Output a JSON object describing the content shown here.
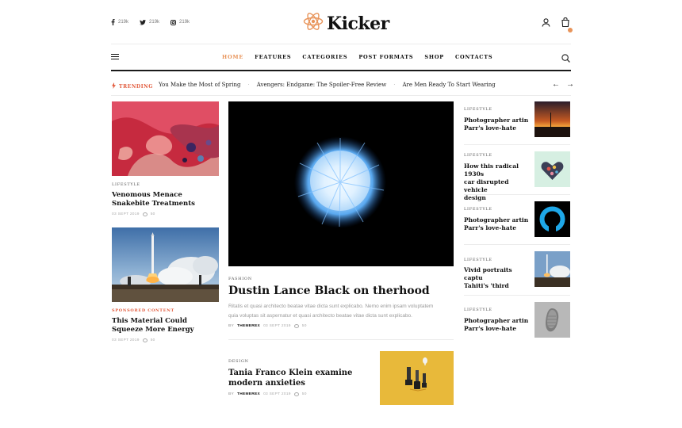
{
  "social": [
    {
      "icon": "facebook-icon",
      "count": "219k"
    },
    {
      "icon": "twitter-icon",
      "count": "219k"
    },
    {
      "icon": "instagram-icon",
      "count": "219k"
    }
  ],
  "brand": {
    "name": "Kicker",
    "accent": "#e8945a",
    "trend_color": "#e25a3c"
  },
  "nav": {
    "items": [
      "HOME",
      "FEATURES",
      "CATEGORIES",
      "POST FORMATS",
      "SHOP",
      "CONTACTS"
    ],
    "active": "HOME"
  },
  "trending": {
    "label": "TRENDING",
    "items": [
      "You Make the Most of Spring",
      "Avengers: Endgame: The Spoiler-Free Review",
      "Are Men Ready To Start Wearing"
    ],
    "prev": "←",
    "next": "→"
  },
  "left": [
    {
      "category": "LIFESTYLE",
      "title": "Venomous Menace Snakebite Treatments",
      "date": "03 SEPT 2019",
      "comments": "50"
    },
    {
      "category": "SPONSORED CONTENT",
      "title": "This Material Could Squeeze More Energy",
      "date": "03 SEPT 2019",
      "comments": "50"
    }
  ],
  "featured": {
    "category": "FASHION",
    "title": "Dustin Lance Black on therhood",
    "excerpt_1": "Ritatis et quasi architecto beatae vitae dicta sunt explicabo. Nemo enim ipsam voluptatem",
    "excerpt_2": "quia voluptas sit aspernatur et quasi architecto beatae vitae dicta sunt explicabo.",
    "by": "BY",
    "author": "THEMEREX",
    "date": "03 SEPT 2019",
    "comments": "50"
  },
  "secondary": {
    "category": "DESIGN",
    "title_1": "Tania Franco Klein examine",
    "title_2": "modern anxieties",
    "by": "BY",
    "author": "THEMEREX",
    "date": "03 SEPT 2019",
    "comments": "50"
  },
  "right": [
    {
      "category": "LIFESTYLE",
      "title_1": "Photographer artin",
      "title_2": "Parr's love-hate",
      "title_3": ""
    },
    {
      "category": "LIFESTYLE",
      "title_1": "How this radical 1930s",
      "title_2": "car disrupted vehicle",
      "title_3": "design"
    },
    {
      "category": "LIFESTYLE",
      "title_1": "Photographer artin",
      "title_2": "Parr's love-hate",
      "title_3": ""
    },
    {
      "category": "LIFESTYLE",
      "title_1": "Vivid portraits captu",
      "title_2": "Tahiti's 'third",
      "title_3": ""
    },
    {
      "category": "LIFESTYLE",
      "title_1": "Photographer artin",
      "title_2": "Parr's love-hate",
      "title_3": ""
    }
  ]
}
